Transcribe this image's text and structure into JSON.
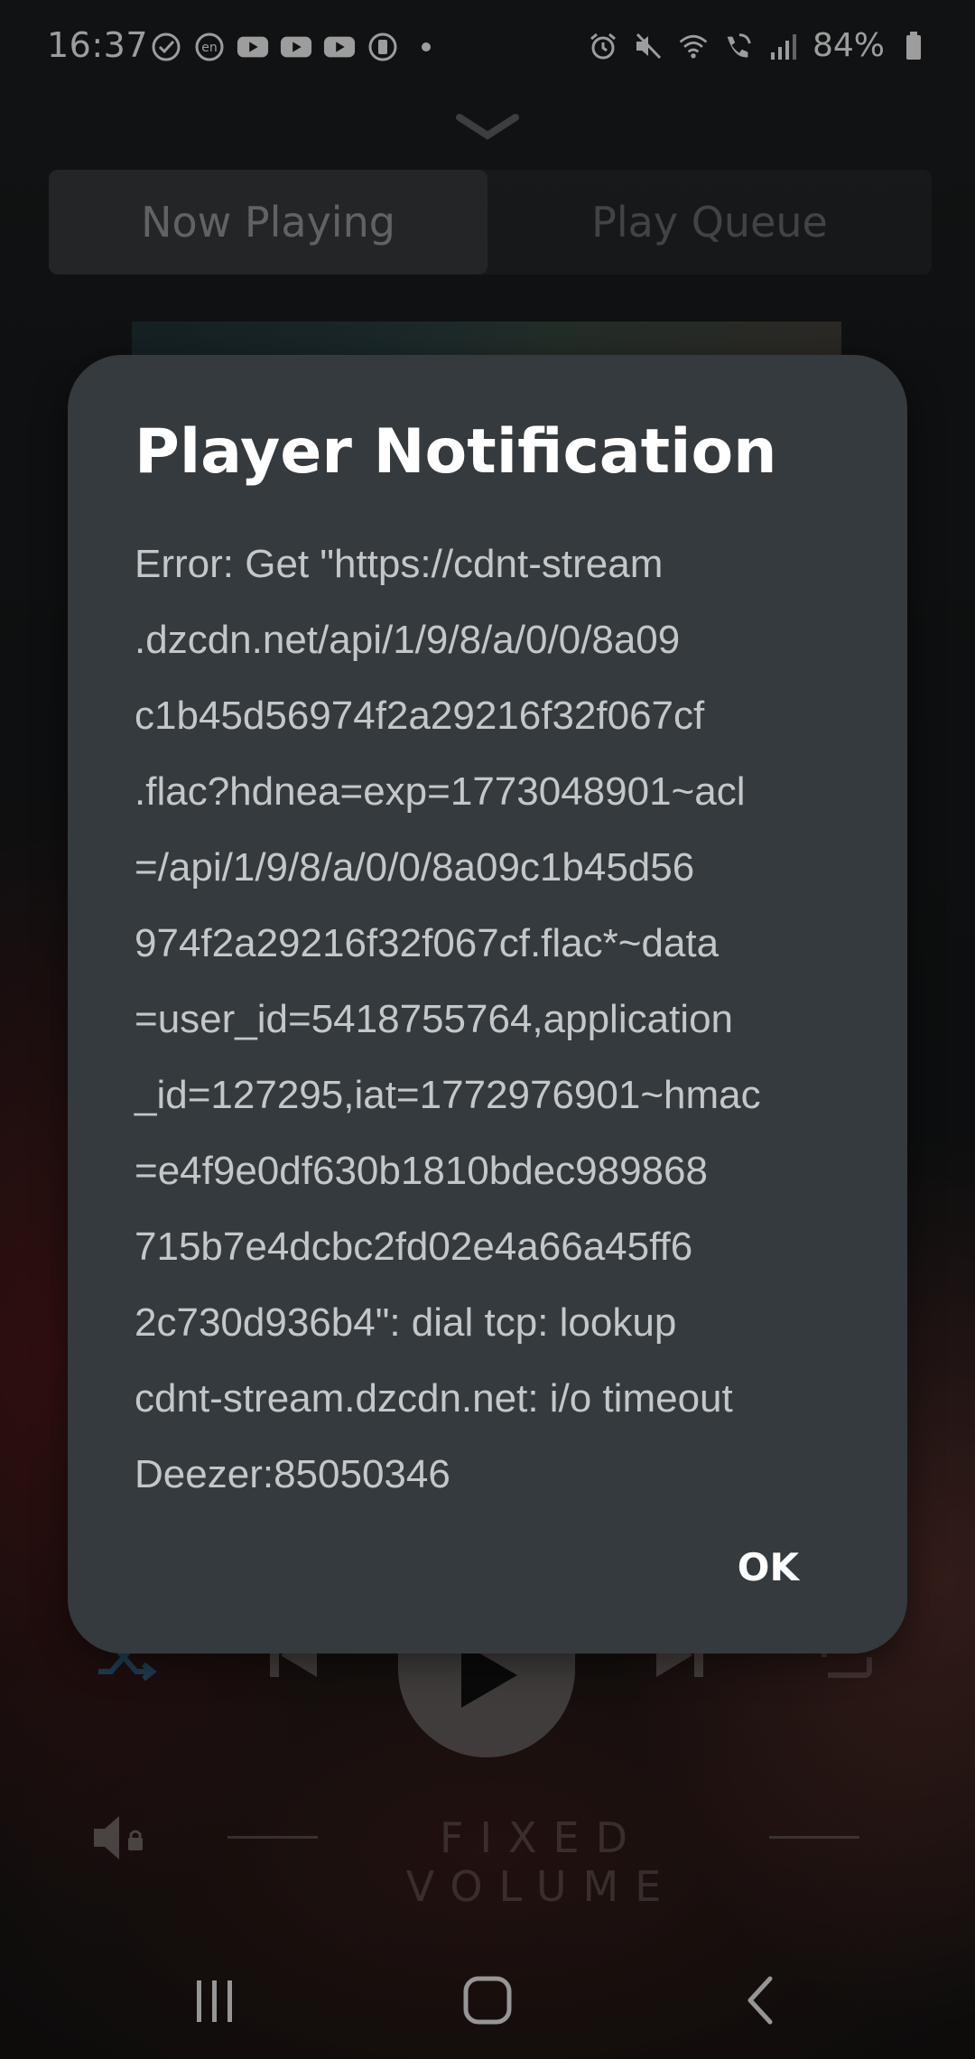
{
  "status_bar": {
    "time": "16:37",
    "battery": "84%",
    "left_icons": [
      "check-circle-icon",
      "en-badge-icon",
      "youtube-icon",
      "youtube-icon",
      "youtube-icon",
      "battery-saver-icon",
      "dot-icon"
    ],
    "right_icons": [
      "alarm-icon",
      "mute-icon",
      "wifi-icon",
      "wifi-calling-icon",
      "signal-icon",
      "battery-icon"
    ]
  },
  "player": {
    "tabs": [
      {
        "label": "Now Playing",
        "active": true
      },
      {
        "label": "Play Queue",
        "active": false
      }
    ],
    "volume_label": "FIXED VOLUME"
  },
  "dialog": {
    "title": "Player Notification",
    "body_lines": [
      "Error: Get \"https://cdnt-stream",
      ".dzcdn.net/api/1/9/8/a/0/0/8a09",
      "c1b45d56974f2a29216f32f067cf",
      ".flac?hdnea=exp=1773048901~acl",
      "=/api/1/9/8/a/0/0/8a09c1b45d56",
      "974f2a29216f32f067cf.flac*~data",
      "=user_id=5418755764,application",
      "_id=127295,iat=1772976901~hmac",
      "=e4f9e0df630b1810bdec989868",
      "715b7e4dcbc2fd02e4a66a45ff6",
      "2c730d936b4\": dial tcp: lookup",
      "cdnt-stream.dzcdn.net: i/o timeout",
      "Deezer:85050346"
    ],
    "ok_label": "OK"
  },
  "colors": {
    "dialog_bg": "#343a3d",
    "dialog_text": "#c4c7c9",
    "accent_shuffle": "#2e5f80"
  }
}
